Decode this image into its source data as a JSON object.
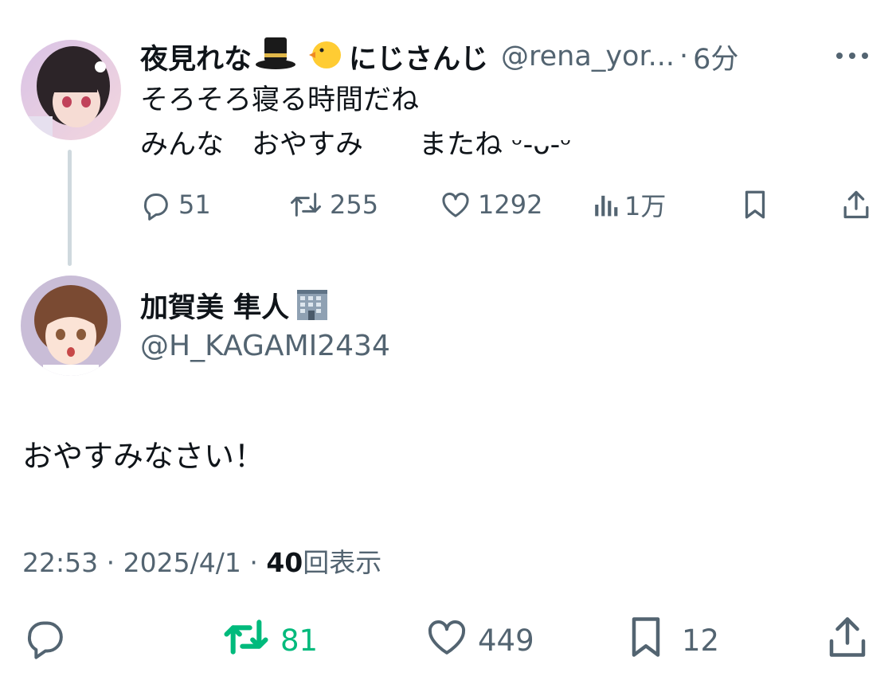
{
  "parent_tweet": {
    "display_name": "夜見れな",
    "badge_text": "にじさんじ",
    "handle": "@rena_yor...",
    "separator": "·",
    "time_ago": "6分",
    "line1": "そろそろ寝る時間だね",
    "line2": "みんな　おやすみ　　またね ᵕ-ᴗ-ᵕ",
    "replies": "51",
    "retweets": "255",
    "likes": "1292",
    "views": "1万",
    "more_icon": "more-dots-icon"
  },
  "reply_tweet": {
    "display_name": "加賀美 隼人",
    "handle": "@H_KAGAMI2434",
    "text": "おやすみなさい！",
    "time": "22:53",
    "sep1": "·",
    "date": "2025/4/1",
    "sep2": "·",
    "view_count": "40",
    "view_label": "回表示",
    "retweets": "81",
    "likes": "449",
    "bookmarks": "12"
  },
  "colors": {
    "text": "#0f1419",
    "secondary": "#536471",
    "retweet_active": "#00ba7c",
    "thread_line": "#cfd9de"
  }
}
